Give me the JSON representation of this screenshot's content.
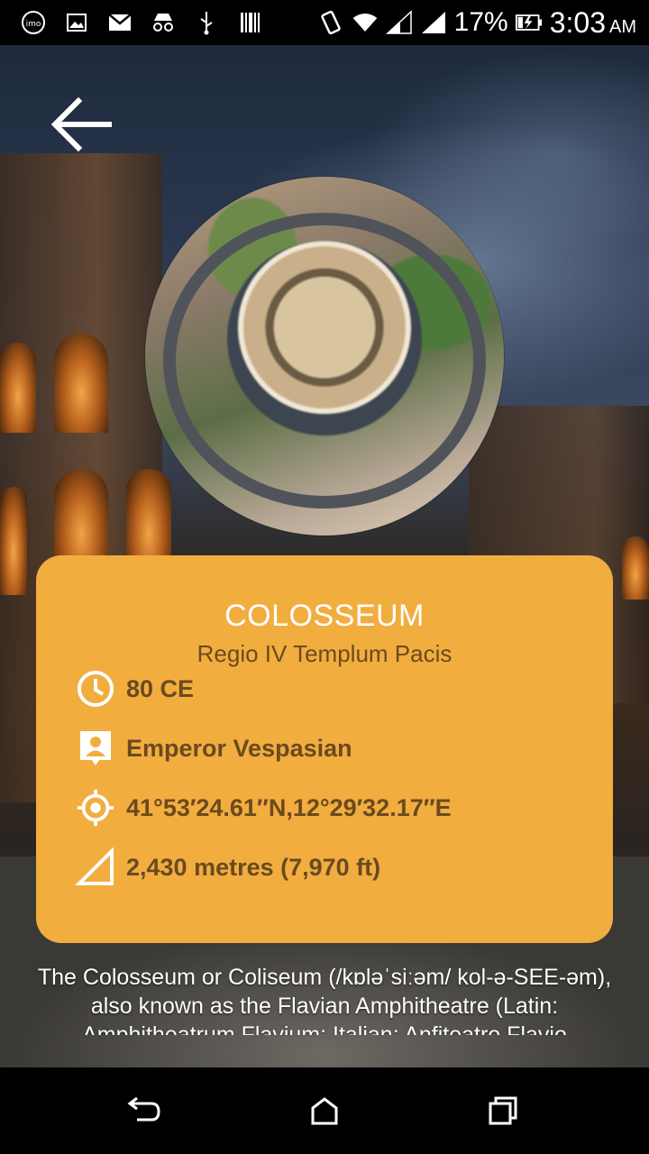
{
  "status_bar": {
    "battery_percent": "17%",
    "time": "3:03",
    "ampm": "AM",
    "icons": [
      "imo-icon",
      "image-icon",
      "gmail-icon",
      "incognito-icon",
      "usb-icon",
      "barcode-icon",
      "vibrate-icon",
      "wifi-icon",
      "signal-icon",
      "signal-icon",
      "battery-charging-icon"
    ]
  },
  "header": {
    "back_icon": "arrow-left-icon"
  },
  "place": {
    "title": "COLOSSEUM",
    "subtitle": "Regio IV Templum Pacis",
    "details": [
      {
        "icon": "clock-icon",
        "text": "80 CE"
      },
      {
        "icon": "person-badge-icon",
        "text": "Emperor Vespasian"
      },
      {
        "icon": "gps-target-icon",
        "text": "41°53′24.61″N,12°29′32.17″E"
      },
      {
        "icon": "triangle-ruler-icon",
        "text": "2,430 metres (7,970 ft)"
      }
    ],
    "description": "The Colosseum or Coliseum (/kɒləˈsiːəm/ kol-ə-SEE-əm), also known as the Flavian Amphitheatre (Latin: Amphitheatrum Flavium; Italian: Anfiteatro Flavio"
  },
  "colors": {
    "card": "#f2ad3f",
    "card_text": "#6a4a1e",
    "title_text": "#ffffff"
  },
  "nav": {
    "back": "nav-back-icon",
    "home": "nav-home-icon",
    "recents": "nav-recents-icon"
  }
}
